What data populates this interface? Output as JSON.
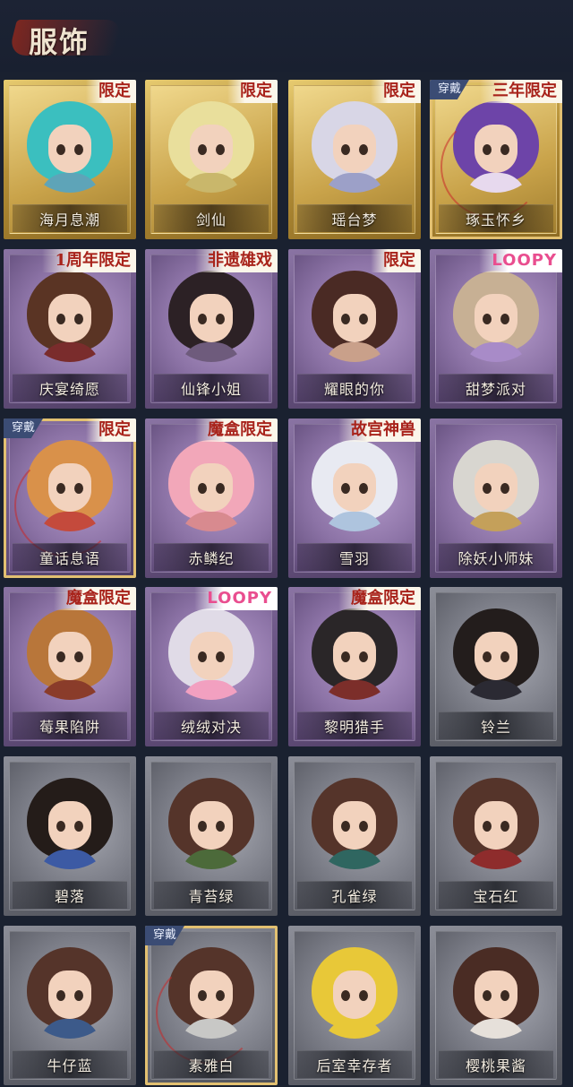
{
  "header": {
    "title": "服饰"
  },
  "cards": [
    {
      "name": "海月息潮",
      "frame": "gold",
      "badge": "限定",
      "badge_style": "red",
      "equipped": false,
      "hair": "#3bbfbf",
      "outfit": "#5ea4b8"
    },
    {
      "name": "剑仙",
      "frame": "gold",
      "badge": "限定",
      "badge_style": "red",
      "equipped": false,
      "hair": "#e9df9c",
      "outfit": "#c9b76b"
    },
    {
      "name": "瑶台梦",
      "frame": "gold",
      "badge": "限定",
      "badge_style": "red",
      "equipped": false,
      "hair": "#d8d6e6",
      "outfit": "#9ca0c8"
    },
    {
      "name": "琢玉怀乡",
      "frame": "gold",
      "badge": "三年限定",
      "badge_style": "red",
      "equipped": true,
      "hair": "#6d44a8",
      "outfit": "#e7d9ee"
    },
    {
      "name": "庆宴绮愿",
      "frame": "purple",
      "badge": "1周年限定",
      "badge_style": "red",
      "equipped": false,
      "hair": "#5a3424",
      "outfit": "#7a2c2c"
    },
    {
      "name": "仙锋小姐",
      "frame": "purple",
      "badge": "非遗雄戏",
      "badge_style": "red",
      "equipped": false,
      "hair": "#2c2125",
      "outfit": "#6e5b7c"
    },
    {
      "name": "耀眼的你",
      "frame": "purple",
      "badge": "限定",
      "badge_style": "red",
      "equipped": false,
      "hair": "#4a2a24",
      "outfit": "#c9a08a"
    },
    {
      "name": "甜梦派对",
      "frame": "purple",
      "badge": "LOOPY",
      "badge_style": "loopy",
      "equipped": false,
      "hair": "#c7b094",
      "outfit": "#a88bc8"
    },
    {
      "name": "童话息语",
      "frame": "purple",
      "badge": "限定",
      "badge_style": "red",
      "equipped": true,
      "hair": "#d9914a",
      "outfit": "#c44a3c"
    },
    {
      "name": "赤鳞纪",
      "frame": "purple",
      "badge": "魔盒限定",
      "badge_style": "red",
      "equipped": false,
      "hair": "#f2a7b9",
      "outfit": "#d88a8f"
    },
    {
      "name": "雪羽",
      "frame": "purple",
      "badge": "故宫神兽",
      "badge_style": "red",
      "equipped": false,
      "hair": "#e8eaf2",
      "outfit": "#aec4de"
    },
    {
      "name": "除妖小师妹",
      "frame": "purple",
      "badge": "",
      "badge_style": "red",
      "equipped": false,
      "hair": "#d8d6d0",
      "outfit": "#c4a05a"
    },
    {
      "name": "莓果陷阱",
      "frame": "purple",
      "badge": "魔盒限定",
      "badge_style": "red",
      "equipped": false,
      "hair": "#b8763a",
      "outfit": "#8a3c2a"
    },
    {
      "name": "绒绒对决",
      "frame": "purple",
      "badge": "LOOPY",
      "badge_style": "loopy",
      "equipped": false,
      "hair": "#e0dbe7",
      "outfit": "#f2a0c0"
    },
    {
      "name": "黎明猎手",
      "frame": "purple",
      "badge": "魔盒限定",
      "badge_style": "red",
      "equipped": false,
      "hair": "#2a2628",
      "outfit": "#7c2e2a"
    },
    {
      "name": "铃兰",
      "frame": "grey",
      "badge": "",
      "badge_style": "red",
      "equipped": false,
      "hair": "#231d1c",
      "outfit": "#2b2a33"
    },
    {
      "name": "碧落",
      "frame": "grey",
      "badge": "",
      "badge_style": "red",
      "equipped": false,
      "hair": "#241c19",
      "outfit": "#3c5aa4"
    },
    {
      "name": "青苔绿",
      "frame": "grey",
      "badge": "",
      "badge_style": "red",
      "equipped": false,
      "hair": "#55342a",
      "outfit": "#4c6a3a"
    },
    {
      "name": "孔雀绿",
      "frame": "grey",
      "badge": "",
      "badge_style": "red",
      "equipped": false,
      "hair": "#55342a",
      "outfit": "#2f6660"
    },
    {
      "name": "宝石红",
      "frame": "grey",
      "badge": "",
      "badge_style": "red",
      "equipped": false,
      "hair": "#55342a",
      "outfit": "#8e2c2c"
    },
    {
      "name": "牛仔蓝",
      "frame": "grey",
      "badge": "",
      "badge_style": "red",
      "equipped": false,
      "hair": "#55342a",
      "outfit": "#3c5a8a"
    },
    {
      "name": "素雅白",
      "frame": "grey",
      "badge": "",
      "badge_style": "red",
      "equipped": true,
      "hair": "#55342a",
      "outfit": "#c8c8c6"
    },
    {
      "name": "后室幸存者",
      "frame": "grey",
      "badge": "",
      "badge_style": "red",
      "equipped": false,
      "hair": "#e8c838",
      "outfit": "#e8c838"
    },
    {
      "name": "樱桃果酱",
      "frame": "grey",
      "badge": "",
      "badge_style": "red",
      "equipped": false,
      "hair": "#4a2c24",
      "outfit": "#e6e0da"
    }
  ],
  "wear_label": "穿戴"
}
